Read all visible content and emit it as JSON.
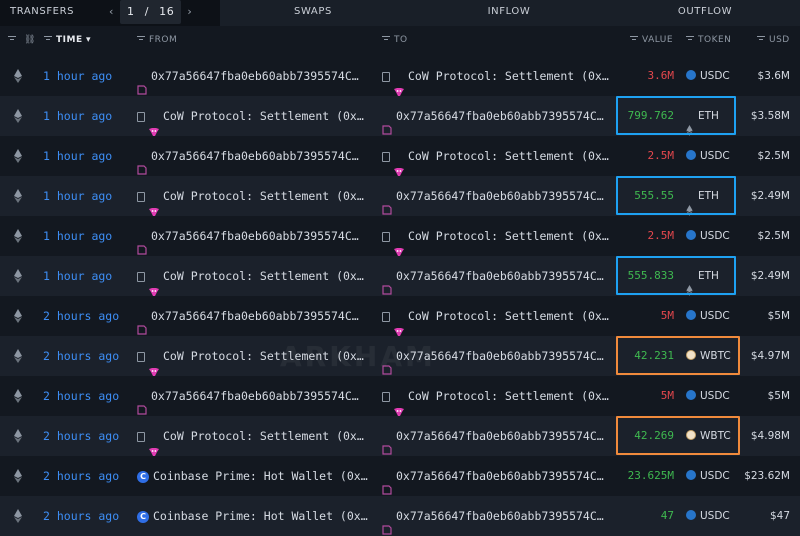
{
  "tabs": {
    "transfers": "TRANSFERS",
    "page_current": "1",
    "page_sep": "/",
    "page_total": "16",
    "swaps": "SWAPS",
    "inflow": "INFLOW",
    "outflow": "OUTFLOW"
  },
  "columns": {
    "time": "TIME",
    "from": "FROM",
    "to": "TO",
    "value": "VALUE",
    "token": "TOKEN",
    "usd": "USD"
  },
  "watermark": "ARKHAM",
  "colors": {
    "accent": "#3d8ef5",
    "outflow": "#e5484d",
    "inflow": "#3fb950",
    "highlight_eth": "#1ea1f2",
    "highlight_wbtc": "#f08a3c"
  },
  "rows": [
    {
      "time": "1 hour ago",
      "from": "0x77a56647fba0eb60abb7395574C…",
      "from_type": "wallet",
      "to": "CoW Protocol: Settlement (0x…",
      "to_type": "cow",
      "value": "3.6M",
      "direction": "out",
      "token": "USDC",
      "usd": "$3.6M",
      "highlight": ""
    },
    {
      "time": "1 hour ago",
      "from": "CoW Protocol: Settlement (0x…",
      "from_type": "cow",
      "to": "0x77a56647fba0eb60abb7395574C…",
      "to_type": "wallet",
      "value": "799.762",
      "direction": "in",
      "token": "ETH",
      "usd": "$3.58M",
      "highlight": "blue"
    },
    {
      "time": "1 hour ago",
      "from": "0x77a56647fba0eb60abb7395574C…",
      "from_type": "wallet",
      "to": "CoW Protocol: Settlement (0x…",
      "to_type": "cow",
      "value": "2.5M",
      "direction": "out",
      "token": "USDC",
      "usd": "$2.5M",
      "highlight": ""
    },
    {
      "time": "1 hour ago",
      "from": "CoW Protocol: Settlement (0x…",
      "from_type": "cow",
      "to": "0x77a56647fba0eb60abb7395574C…",
      "to_type": "wallet",
      "value": "555.55",
      "direction": "in",
      "token": "ETH",
      "usd": "$2.49M",
      "highlight": "blue"
    },
    {
      "time": "1 hour ago",
      "from": "0x77a56647fba0eb60abb7395574C…",
      "from_type": "wallet",
      "to": "CoW Protocol: Settlement (0x…",
      "to_type": "cow",
      "value": "2.5M",
      "direction": "out",
      "token": "USDC",
      "usd": "$2.5M",
      "highlight": ""
    },
    {
      "time": "1 hour ago",
      "from": "CoW Protocol: Settlement (0x…",
      "from_type": "cow",
      "to": "0x77a56647fba0eb60abb7395574C…",
      "to_type": "wallet",
      "value": "555.833",
      "direction": "in",
      "token": "ETH",
      "usd": "$2.49M",
      "highlight": "blue"
    },
    {
      "time": "2 hours ago",
      "from": "0x77a56647fba0eb60abb7395574C…",
      "from_type": "wallet",
      "to": "CoW Protocol: Settlement (0x…",
      "to_type": "cow",
      "value": "5M",
      "direction": "out",
      "token": "USDC",
      "usd": "$5M",
      "highlight": ""
    },
    {
      "time": "2 hours ago",
      "from": "CoW Protocol: Settlement (0x…",
      "from_type": "cow",
      "to": "0x77a56647fba0eb60abb7395574C…",
      "to_type": "wallet",
      "value": "42.231",
      "direction": "in",
      "token": "WBTC",
      "usd": "$4.97M",
      "highlight": "orange"
    },
    {
      "time": "2 hours ago",
      "from": "0x77a56647fba0eb60abb7395574C…",
      "from_type": "wallet",
      "to": "CoW Protocol: Settlement (0x…",
      "to_type": "cow",
      "value": "5M",
      "direction": "out",
      "token": "USDC",
      "usd": "$5M",
      "highlight": ""
    },
    {
      "time": "2 hours ago",
      "from": "CoW Protocol: Settlement (0x…",
      "from_type": "cow",
      "to": "0x77a56647fba0eb60abb7395574C…",
      "to_type": "wallet",
      "value": "42.269",
      "direction": "in",
      "token": "WBTC",
      "usd": "$4.98M",
      "highlight": "orange"
    },
    {
      "time": "2 hours ago",
      "from": "Coinbase Prime: Hot Wallet (0x…",
      "from_type": "coinbase",
      "to": "0x77a56647fba0eb60abb7395574C…",
      "to_type": "wallet",
      "value": "23.625M",
      "direction": "in",
      "token": "USDC",
      "usd": "$23.62M",
      "highlight": ""
    },
    {
      "time": "2 hours ago",
      "from": "Coinbase Prime: Hot Wallet (0x…",
      "from_type": "coinbase",
      "to": "0x77a56647fba0eb60abb7395574C…",
      "to_type": "wallet",
      "value": "47",
      "direction": "in",
      "token": "USDC",
      "usd": "$47",
      "highlight": ""
    }
  ]
}
